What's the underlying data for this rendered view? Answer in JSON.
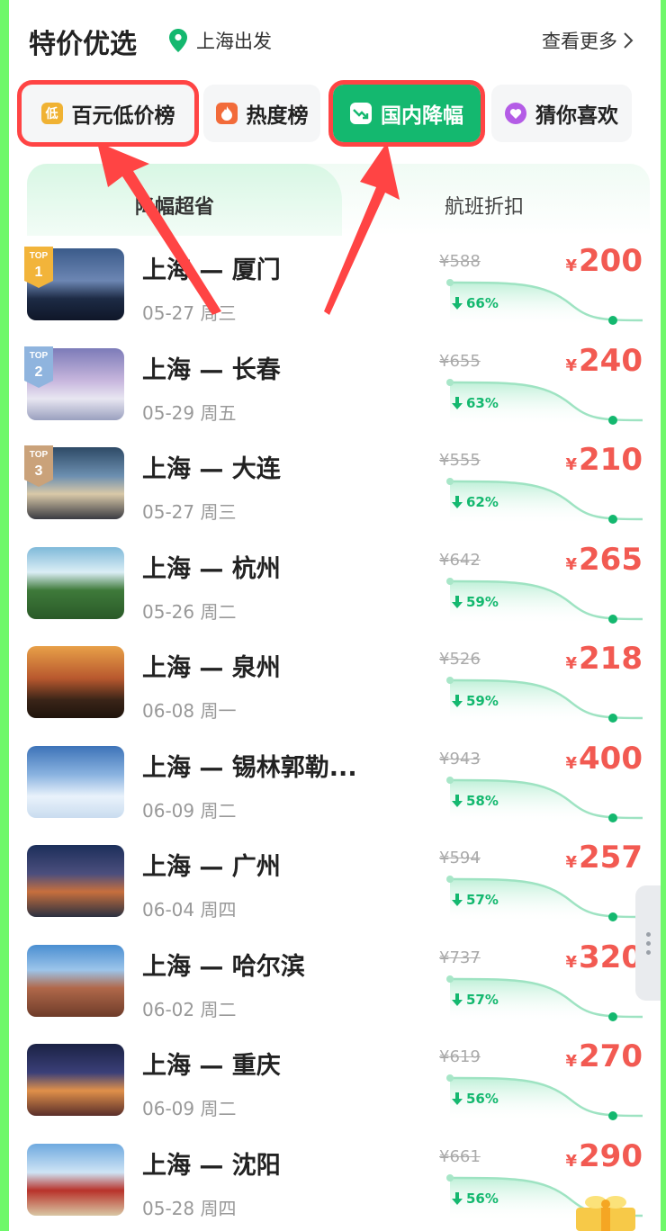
{
  "header": {
    "title": "特价优选",
    "location": "上海出发",
    "more": "查看更多"
  },
  "chips": [
    {
      "label": "百元低价榜",
      "icon": "low-price-icon",
      "icon_text": "低"
    },
    {
      "label": "热度榜",
      "icon": "flame-icon"
    },
    {
      "label": "国内降幅",
      "icon": "trend-down-icon"
    },
    {
      "label": "猜你喜欢",
      "icon": "heart-icon"
    }
  ],
  "tabs": [
    {
      "label": "降幅超省"
    },
    {
      "label": "航班折扣"
    }
  ],
  "rank_badge_text": "TOP",
  "rows": [
    {
      "route": "上海 — 厦门",
      "date": "05-27 周三",
      "old": "¥588",
      "pct": "66%",
      "yen": "¥",
      "price": "200",
      "rank": "1",
      "img": "skyline-night"
    },
    {
      "route": "上海 — 长春",
      "date": "05-29 周五",
      "old": "¥655",
      "pct": "63%",
      "yen": "¥",
      "price": "240",
      "rank": "2",
      "img": "bridge"
    },
    {
      "route": "上海 — 大连",
      "date": "05-27 周三",
      "old": "¥555",
      "pct": "62%",
      "yen": "¥",
      "price": "210",
      "rank": "3",
      "img": "tower"
    },
    {
      "route": "上海 — 杭州",
      "date": "05-26 周二",
      "old": "¥642",
      "pct": "59%",
      "yen": "¥",
      "price": "265",
      "rank": "",
      "img": "lake"
    },
    {
      "route": "上海 — 泉州",
      "date": "06-08 周一",
      "old": "¥526",
      "pct": "59%",
      "yen": "¥",
      "price": "218",
      "rank": "",
      "img": "pagoda"
    },
    {
      "route": "上海 — 锡林郭勒...",
      "date": "06-09 周二",
      "old": "¥943",
      "pct": "58%",
      "yen": "¥",
      "price": "400",
      "rank": "",
      "img": "clouds"
    },
    {
      "route": "上海 — 广州",
      "date": "06-04 周四",
      "old": "¥594",
      "pct": "57%",
      "yen": "¥",
      "price": "257",
      "rank": "",
      "img": "city-river"
    },
    {
      "route": "上海 — 哈尔滨",
      "date": "06-02 周二",
      "old": "¥737",
      "pct": "57%",
      "yen": "¥",
      "price": "320",
      "rank": "",
      "img": "cathedral"
    },
    {
      "route": "上海 — 重庆",
      "date": "06-09 周二",
      "old": "¥619",
      "pct": "56%",
      "yen": "¥",
      "price": "270",
      "rank": "",
      "img": "night-buildings"
    },
    {
      "route": "上海 — 沈阳",
      "date": "05-28 周四",
      "old": "¥661",
      "pct": "56%",
      "yen": "¥",
      "price": "290",
      "rank": "",
      "img": "palace"
    }
  ],
  "colors": {
    "brand_green": "#14b86f",
    "price_red": "#f25a52",
    "highlight_red": "#ff4444",
    "frame_green": "#6ef86a"
  }
}
